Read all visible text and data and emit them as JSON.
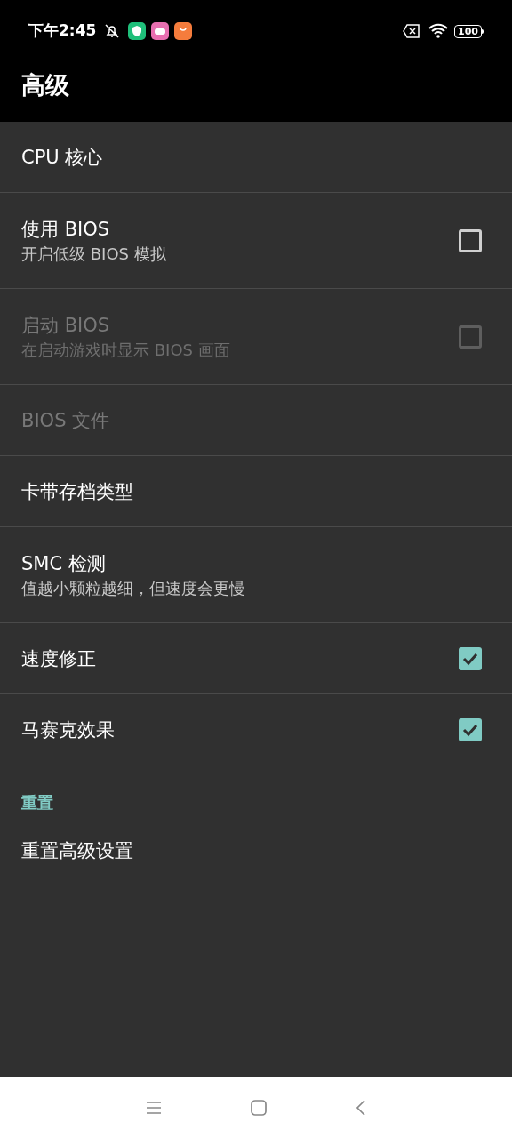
{
  "status_bar": {
    "time": "下午2:45",
    "battery": "100"
  },
  "toolbar": {
    "title": "高级"
  },
  "items": [
    {
      "kind": "plain",
      "title": "CPU 核心",
      "disabled": false
    },
    {
      "kind": "checkbox",
      "title": "使用 BIOS",
      "summary": "开启低级 BIOS 模拟",
      "disabled": false,
      "checked": false
    },
    {
      "kind": "checkbox",
      "title": "启动 BIOS",
      "summary": "在启动游戏时显示 BIOS 画面",
      "disabled": true,
      "checked": false
    },
    {
      "kind": "plain",
      "title": "BIOS 文件",
      "disabled": true
    },
    {
      "kind": "plain",
      "title": "卡带存档类型",
      "disabled": false
    },
    {
      "kind": "plain",
      "title": "SMC 检测",
      "summary": "值越小颗粒越细，但速度会更慢",
      "disabled": false
    },
    {
      "kind": "checkbox",
      "title": "速度修正",
      "disabled": false,
      "checked": true
    },
    {
      "kind": "checkbox",
      "title": "马赛克效果",
      "disabled": false,
      "checked": true
    }
  ],
  "section": {
    "title": "重置",
    "items": [
      {
        "kind": "plain",
        "title": "重置高级设置",
        "disabled": false
      }
    ]
  }
}
